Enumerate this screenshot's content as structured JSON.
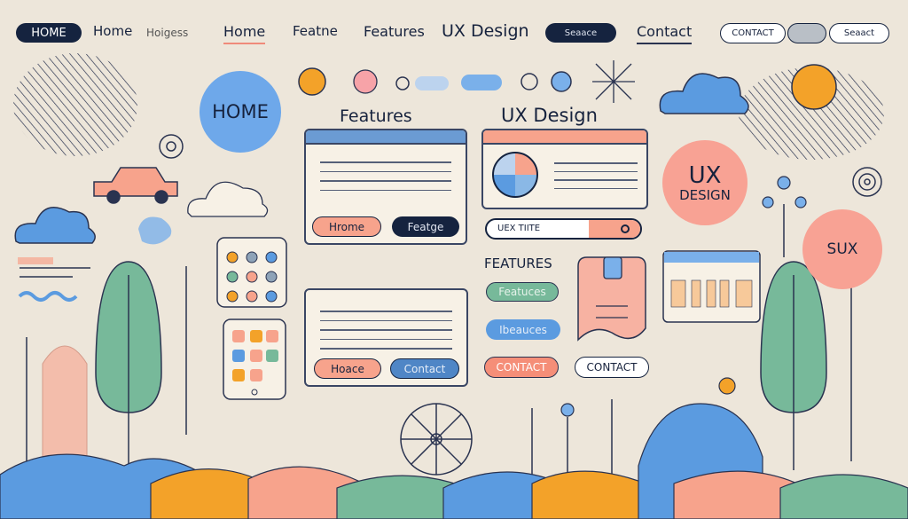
{
  "nav": {
    "home_pill": "HOME",
    "items": [
      "Home",
      "Hoigess",
      "Home",
      "Featne",
      "Features",
      "UX Design"
    ],
    "dark_pill": "Seaace",
    "contact": "Contact",
    "outlined_pills": [
      "CONTACT",
      "",
      "Seaact"
    ]
  },
  "bubbles": {
    "home": "HOME",
    "ux_design_line1": "UX",
    "ux_design_line2": "DESIGN",
    "sux": "SUX"
  },
  "features_panel": {
    "title": "Features",
    "button_primary": "Hrome",
    "button_secondary": "Featge"
  },
  "ux_panel": {
    "title": "UX Design",
    "search_value": "UEX TIITE"
  },
  "lower_panel": {
    "button_primary": "Hoace",
    "button_secondary": "Contact"
  },
  "features_list": {
    "heading": "FEATURES",
    "pills": [
      "Featuces",
      "Ibeauces",
      "CONTACT",
      "CONTACT"
    ]
  },
  "colors": {
    "background": "#ede6da",
    "navy": "#15233f",
    "salmon": "#f7a38c",
    "blue": "#5b9be0",
    "green": "#77b99a",
    "orange": "#f3a229"
  }
}
